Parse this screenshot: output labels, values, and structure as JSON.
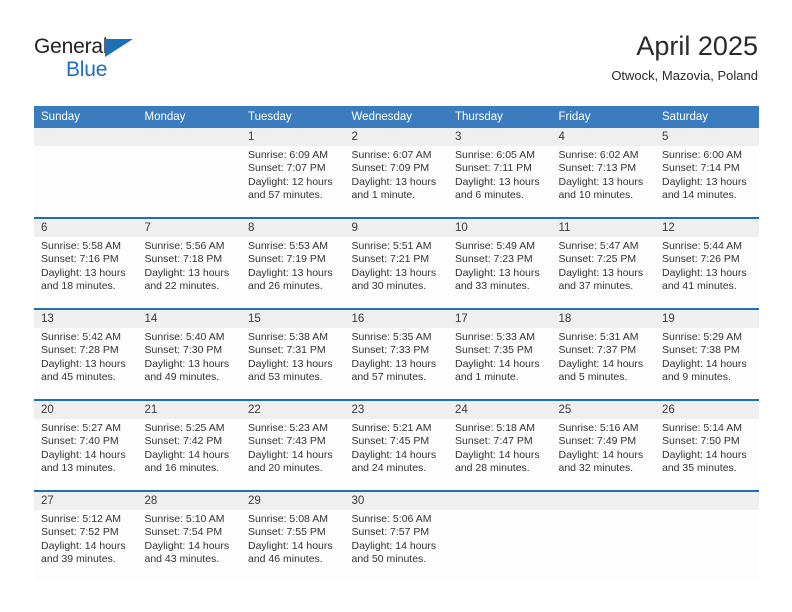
{
  "brand": {
    "name_part1": "General",
    "name_part2": "Blue",
    "accent_color": "#1d70b8",
    "triangle_icon": "triangle-icon"
  },
  "header": {
    "title": "April 2025",
    "location": "Otwock, Mazovia, Poland"
  },
  "calendar": {
    "header_bg": "#3a7cbe",
    "separator_color": "#1d70b8",
    "daynum_bg": "#efefef",
    "weekdays": [
      "Sunday",
      "Monday",
      "Tuesday",
      "Wednesday",
      "Thursday",
      "Friday",
      "Saturday"
    ],
    "weeks": [
      {
        "numbers": [
          "",
          "",
          "1",
          "2",
          "3",
          "4",
          "5"
        ],
        "cells": [
          "",
          "",
          "Sunrise: 6:09 AM\nSunset: 7:07 PM\nDaylight: 12 hours and 57 minutes.",
          "Sunrise: 6:07 AM\nSunset: 7:09 PM\nDaylight: 13 hours and 1 minute.",
          "Sunrise: 6:05 AM\nSunset: 7:11 PM\nDaylight: 13 hours and 6 minutes.",
          "Sunrise: 6:02 AM\nSunset: 7:13 PM\nDaylight: 13 hours and 10 minutes.",
          "Sunrise: 6:00 AM\nSunset: 7:14 PM\nDaylight: 13 hours and 14 minutes."
        ]
      },
      {
        "numbers": [
          "6",
          "7",
          "8",
          "9",
          "10",
          "11",
          "12"
        ],
        "cells": [
          "Sunrise: 5:58 AM\nSunset: 7:16 PM\nDaylight: 13 hours and 18 minutes.",
          "Sunrise: 5:56 AM\nSunset: 7:18 PM\nDaylight: 13 hours and 22 minutes.",
          "Sunrise: 5:53 AM\nSunset: 7:19 PM\nDaylight: 13 hours and 26 minutes.",
          "Sunrise: 5:51 AM\nSunset: 7:21 PM\nDaylight: 13 hours and 30 minutes.",
          "Sunrise: 5:49 AM\nSunset: 7:23 PM\nDaylight: 13 hours and 33 minutes.",
          "Sunrise: 5:47 AM\nSunset: 7:25 PM\nDaylight: 13 hours and 37 minutes.",
          "Sunrise: 5:44 AM\nSunset: 7:26 PM\nDaylight: 13 hours and 41 minutes."
        ]
      },
      {
        "numbers": [
          "13",
          "14",
          "15",
          "16",
          "17",
          "18",
          "19"
        ],
        "cells": [
          "Sunrise: 5:42 AM\nSunset: 7:28 PM\nDaylight: 13 hours and 45 minutes.",
          "Sunrise: 5:40 AM\nSunset: 7:30 PM\nDaylight: 13 hours and 49 minutes.",
          "Sunrise: 5:38 AM\nSunset: 7:31 PM\nDaylight: 13 hours and 53 minutes.",
          "Sunrise: 5:35 AM\nSunset: 7:33 PM\nDaylight: 13 hours and 57 minutes.",
          "Sunrise: 5:33 AM\nSunset: 7:35 PM\nDaylight: 14 hours and 1 minute.",
          "Sunrise: 5:31 AM\nSunset: 7:37 PM\nDaylight: 14 hours and 5 minutes.",
          "Sunrise: 5:29 AM\nSunset: 7:38 PM\nDaylight: 14 hours and 9 minutes."
        ]
      },
      {
        "numbers": [
          "20",
          "21",
          "22",
          "23",
          "24",
          "25",
          "26"
        ],
        "cells": [
          "Sunrise: 5:27 AM\nSunset: 7:40 PM\nDaylight: 14 hours and 13 minutes.",
          "Sunrise: 5:25 AM\nSunset: 7:42 PM\nDaylight: 14 hours and 16 minutes.",
          "Sunrise: 5:23 AM\nSunset: 7:43 PM\nDaylight: 14 hours and 20 minutes.",
          "Sunrise: 5:21 AM\nSunset: 7:45 PM\nDaylight: 14 hours and 24 minutes.",
          "Sunrise: 5:18 AM\nSunset: 7:47 PM\nDaylight: 14 hours and 28 minutes.",
          "Sunrise: 5:16 AM\nSunset: 7:49 PM\nDaylight: 14 hours and 32 minutes.",
          "Sunrise: 5:14 AM\nSunset: 7:50 PM\nDaylight: 14 hours and 35 minutes."
        ]
      },
      {
        "numbers": [
          "27",
          "28",
          "29",
          "30",
          "",
          "",
          ""
        ],
        "cells": [
          "Sunrise: 5:12 AM\nSunset: 7:52 PM\nDaylight: 14 hours and 39 minutes.",
          "Sunrise: 5:10 AM\nSunset: 7:54 PM\nDaylight: 14 hours and 43 minutes.",
          "Sunrise: 5:08 AM\nSunset: 7:55 PM\nDaylight: 14 hours and 46 minutes.",
          "Sunrise: 5:06 AM\nSunset: 7:57 PM\nDaylight: 14 hours and 50 minutes.",
          "",
          "",
          ""
        ]
      }
    ]
  }
}
